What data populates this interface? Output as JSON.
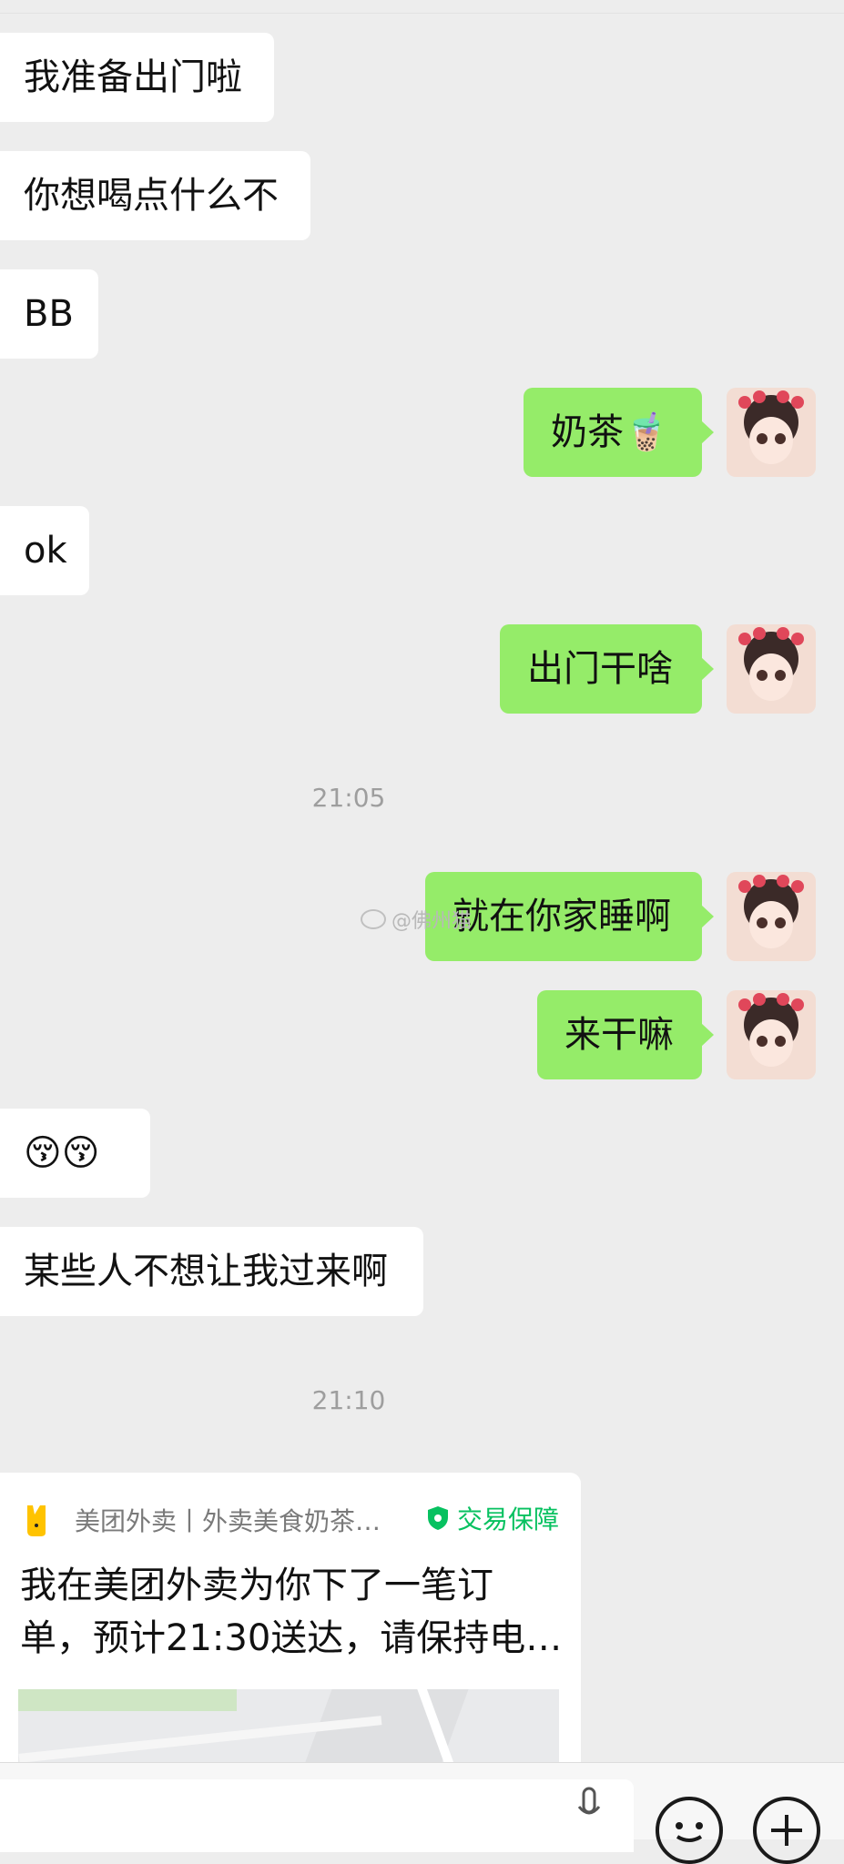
{
  "messages": {
    "m1": "我准备出门啦",
    "m2": "你想喝点什么不",
    "m3": "BB",
    "m4": "奶茶🧋",
    "m5": "ok",
    "m6": "出门干啥",
    "time1": "21:05",
    "m7": "就在你家睡啊",
    "m8": "来干嘛",
    "m9": "😚😚",
    "m10": "某些人不想让我过来啊",
    "time2": "21:10"
  },
  "watermark": "@佛州猫",
  "card": {
    "source": "美团外卖丨外卖美食奶茶…",
    "badge": "交易保障",
    "line1": "我在美团外卖为你下了一笔订",
    "line2": "单，预计21:30送达，请保持电…"
  },
  "colors": {
    "chat_bg": "#ededed",
    "out_bubble": "#95ec69",
    "in_bubble": "#ffffff",
    "badge_green": "#07c160",
    "meituan_yellow": "#ffc300"
  },
  "icons": [
    "meituan-logo-icon",
    "shield-icon",
    "voice-icon",
    "emoji-icon",
    "plus-icon",
    "weibo-icon"
  ]
}
